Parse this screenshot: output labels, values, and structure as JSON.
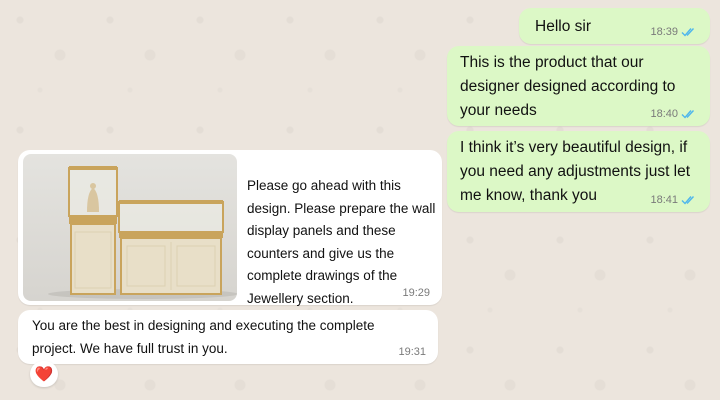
{
  "messages": [
    {
      "id": "b1",
      "direction": "outgoing",
      "text": "Hello sir",
      "time": "18:39",
      "status": "read"
    },
    {
      "id": "b2",
      "direction": "outgoing",
      "text": "This is the product that our designer designed according to your needs",
      "time": "18:40",
      "status": "read"
    },
    {
      "id": "b3",
      "direction": "outgoing",
      "text": "I think it’s very beautiful design, if you need any adjustments just let me know, thank you",
      "time": "18:41",
      "status": "read"
    },
    {
      "id": "b4",
      "direction": "incoming",
      "has_image": true,
      "image_subject": "jewellery display counters",
      "text": "Please go ahead with this design. Please prepare the wall display panels and these counters and give us the complete drawings of the Jewellery section.",
      "time": "19:29"
    },
    {
      "id": "b5",
      "direction": "incoming",
      "text": "You are the best in designing and executing the complete project. We have full trust in you.",
      "time": "19:31",
      "reaction": "❤️"
    }
  ],
  "colors": {
    "background": "#ece5dd",
    "outgoing_bubble": "#dcf8c6",
    "incoming_bubble": "#ffffff",
    "read_ticks": "#4fb6ec",
    "timestamp": "#7a7a7a"
  },
  "icons": {
    "read_receipt": "double-check-icon",
    "reaction": "heart-icon"
  }
}
